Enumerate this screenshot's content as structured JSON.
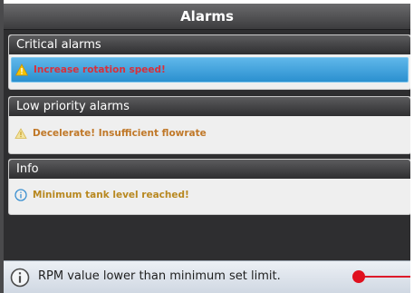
{
  "window": {
    "title": "Alarms"
  },
  "sections": {
    "critical": {
      "header": "Critical alarms",
      "items": [
        {
          "text": "Increase rotation speed!",
          "icon": "warning-triangle-icon"
        }
      ]
    },
    "low": {
      "header": "Low priority alarms",
      "items": [
        {
          "text": "Decelerate! Insufficient flowrate",
          "icon": "warning-triangle-icon"
        }
      ]
    },
    "info": {
      "header": "Info",
      "items": [
        {
          "text": "Minimum tank level reached!",
          "icon": "info-circle-icon"
        }
      ]
    }
  },
  "status_bar": {
    "icon": "info-circle-icon",
    "text": "RPM value lower than minimum set limit."
  },
  "colors": {
    "critical_text": "#d9303a",
    "low_text": "#c07828",
    "info_text": "#b88820",
    "selected_row": "#2b90cf",
    "slider": "#e0101e"
  }
}
